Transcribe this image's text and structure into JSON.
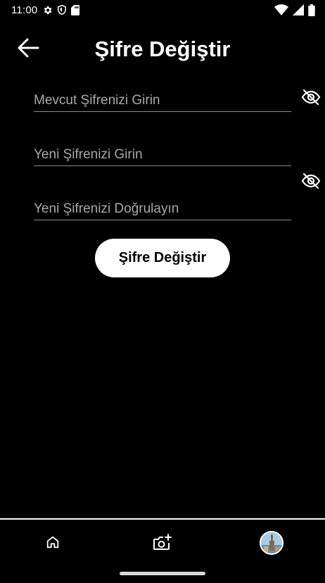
{
  "status_bar": {
    "time": "11:00",
    "left_icons": [
      "gear-icon",
      "shield-icon",
      "sd-card-icon"
    ],
    "right_icons": [
      "wifi-icon",
      "cell-signal-icon",
      "battery-icon"
    ]
  },
  "header": {
    "back_icon": "arrow-left-icon",
    "title": "Şifre Değiştir"
  },
  "form": {
    "current_password": {
      "placeholder": "Mevcut Şifrenizi Girin",
      "value": ""
    },
    "new_password": {
      "placeholder": "Yeni Şifrenizi Girin",
      "value": ""
    },
    "confirm_password": {
      "placeholder": "Yeni Şifrenizi Doğrulayın",
      "value": ""
    },
    "visibility_icon": "eye-off-icon",
    "submit_label": "Şifre Değiştir"
  },
  "bottom_nav": {
    "items": [
      {
        "icon": "home-icon"
      },
      {
        "icon": "add-photo-icon"
      },
      {
        "icon": "profile-avatar"
      }
    ]
  },
  "colors": {
    "background": "#000000",
    "text": "#ffffff",
    "placeholder": "#a8a8a8",
    "underline": "#8a8a8a",
    "button_bg": "#ffffff",
    "button_text": "#000000"
  }
}
